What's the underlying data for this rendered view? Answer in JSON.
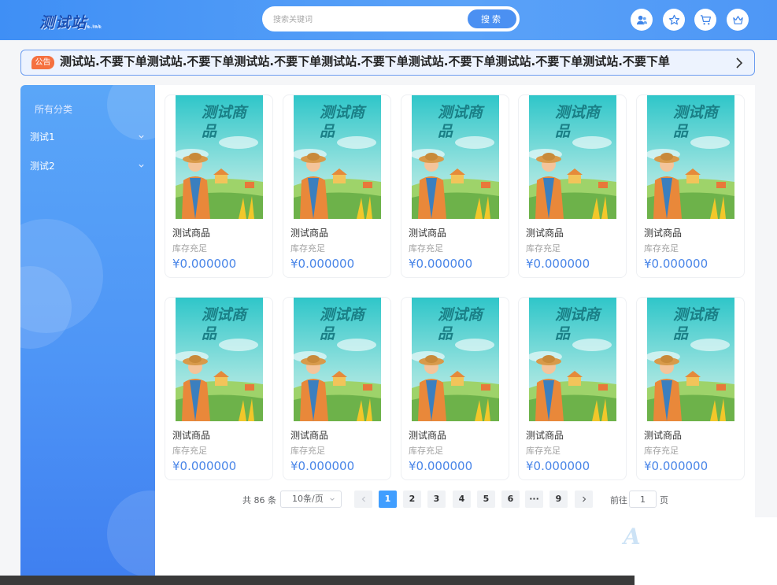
{
  "header": {
    "logo": "测试站",
    "logo_sub": "e.ink",
    "search_placeholder": "搜索关键词",
    "search_button": "搜索"
  },
  "notice": {
    "badge": "公告",
    "text": "测试站.不要下单测试站.不要下单测试站.不要下单测试站.不要下单测试站.不要下单测试站.不要下单测试站.不要下单"
  },
  "sidebar": {
    "title": "所有分类",
    "items": [
      {
        "label": "测试1"
      },
      {
        "label": "测试2"
      }
    ]
  },
  "products": [
    {
      "name": "测试商品",
      "stock": "库存充足",
      "price": "¥0.000000"
    },
    {
      "name": "测试商品",
      "stock": "库存充足",
      "price": "¥0.000000"
    },
    {
      "name": "测试商品",
      "stock": "库存充足",
      "price": "¥0.000000"
    },
    {
      "name": "测试商品",
      "stock": "库存充足",
      "price": "¥0.000000"
    },
    {
      "name": "测试商品",
      "stock": "库存充足",
      "price": "¥0.000000"
    },
    {
      "name": "测试商品",
      "stock": "库存充足",
      "price": "¥0.000000"
    },
    {
      "name": "测试商品",
      "stock": "库存充足",
      "price": "¥0.000000"
    },
    {
      "name": "测试商品",
      "stock": "库存充足",
      "price": "¥0.000000"
    },
    {
      "name": "测试商品",
      "stock": "库存充足",
      "price": "¥0.000000"
    },
    {
      "name": "测试商品",
      "stock": "库存充足",
      "price": "¥0.000000"
    }
  ],
  "product_image_text": "测试商品",
  "pagination": {
    "total": "共 86 条",
    "page_size": "10条/页",
    "pages": [
      "1",
      "2",
      "3",
      "4",
      "5",
      "6",
      "9"
    ],
    "ellipsis": "···",
    "current": "1",
    "goto_label": "前往",
    "goto_value": "1",
    "goto_unit": "页"
  },
  "watermark": "A",
  "colors": {
    "primary": "#4b90f2",
    "notice_badge": "#f5703f",
    "price": "#4a86e8",
    "page_active": "#409eff"
  }
}
